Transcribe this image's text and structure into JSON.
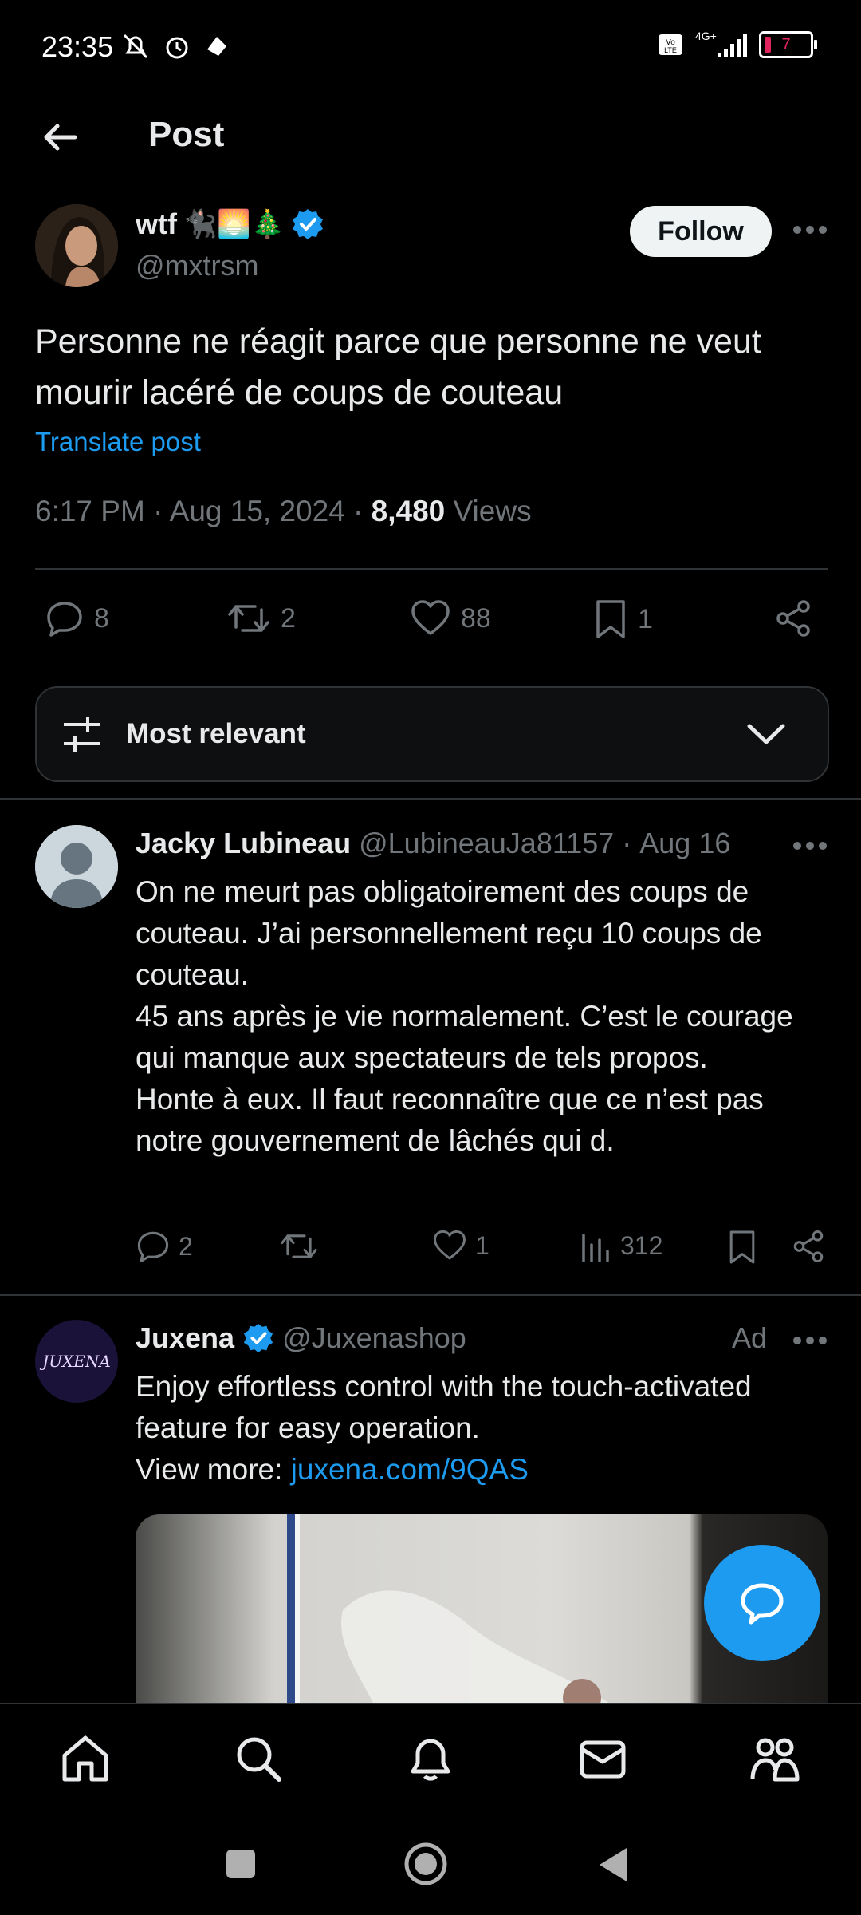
{
  "status_bar": {
    "time": "23:35",
    "battery": "7",
    "network": "4G+"
  },
  "header": {
    "title": "Post"
  },
  "post": {
    "author_name": "wtf",
    "author_emoji": "🐈‍⬛🌅🎄",
    "handle": "@mxtrsm",
    "follow_label": "Follow",
    "text": "Personne ne réagit parce que personne ne veut mourir lacéré de coups de couteau",
    "translate_label": "Translate post",
    "time": "6:17 PM",
    "date": "Aug 15, 2024",
    "views_count": "8,480",
    "views_label": "Views",
    "replies": "8",
    "reposts": "2",
    "likes": "88",
    "bookmarks": "1"
  },
  "sort": {
    "label": "Most relevant"
  },
  "reply": {
    "name": "Jacky Lubineau",
    "handle": "@LubineauJa81157",
    "date": "Aug 16",
    "text": "On ne meurt pas obligatoirement des coups de couteau. J’ai personnellement reçu 10 coups de couteau.\n45 ans après je vie normalement. C’est le courage qui manque aux spectateurs de tels propos.\nHonte à eux. Il faut reconnaître que ce n’est pas notre gouvernement de lâchés qui d.",
    "replies": "2",
    "likes": "1",
    "views": "312"
  },
  "ad": {
    "name": "Juxena",
    "handle": "@Juxenashop",
    "ad_label": "Ad",
    "avatar_text": "JUXENA",
    "text": "Enjoy effortless control with the touch-activated feature for easy operation.",
    "view_more_label": "View more:",
    "link": "juxena.com/9QAS"
  },
  "colors": {
    "accent": "#1d9bf0",
    "background": "#000000",
    "muted": "#71767b"
  }
}
